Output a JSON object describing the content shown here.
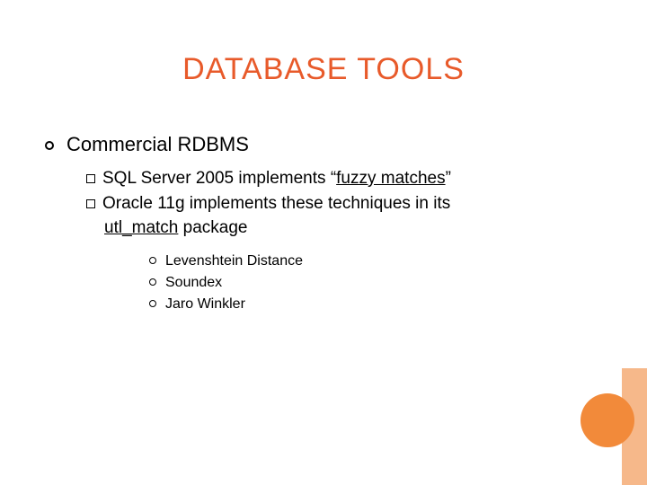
{
  "title": "DATABASE TOOLS",
  "level1": {
    "text": "Commercial RDBMS"
  },
  "level2": {
    "item1": {
      "prefix": "SQL Server 2005 implements ",
      "quote_open": "",
      "link": "fuzzy matches",
      "quote_close": ""
    },
    "item2": {
      "line1_prefix": "Oracle 11g implements these techniques in its",
      "line2_link": "utl_match",
      "line2_suffix": " package"
    }
  },
  "level3": {
    "a": "Levenshtein Distance",
    "b": "Soundex",
    "c": "Jaro Winkler"
  }
}
